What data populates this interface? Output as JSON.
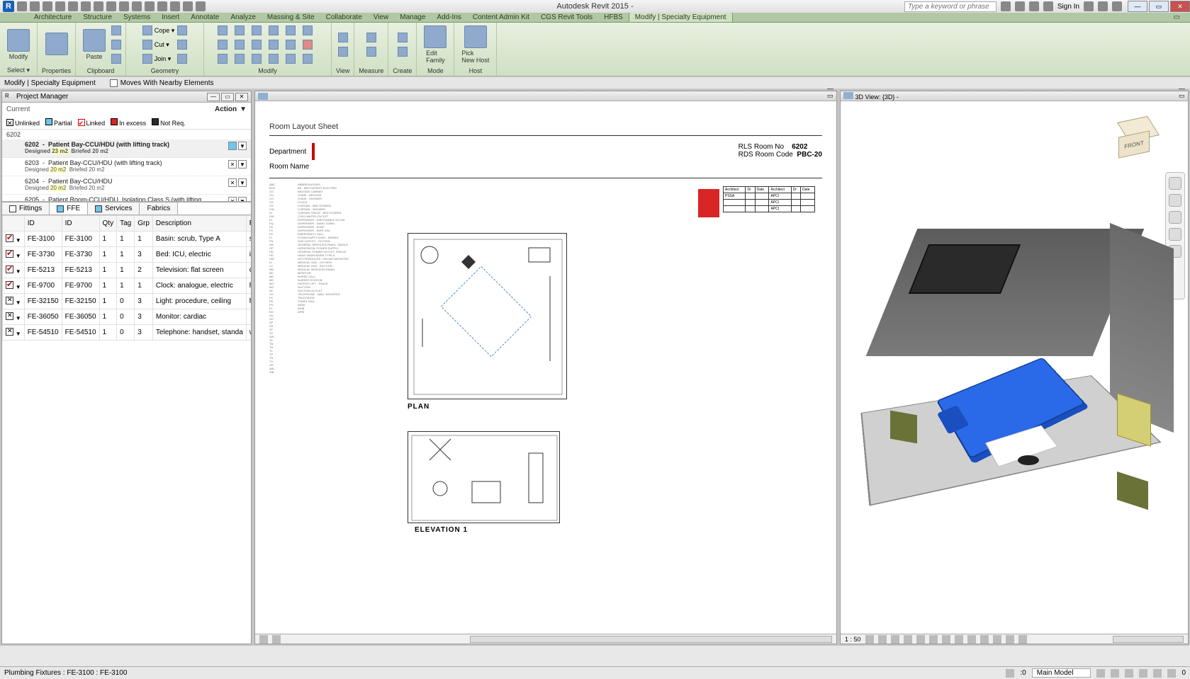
{
  "app": {
    "title": "Autodesk Revit 2015 -",
    "signin": "Sign In",
    "search_placeholder": "Type a keyword or phrase"
  },
  "qat_icons": [
    "open",
    "save",
    "undo",
    "redo",
    "sync",
    "print",
    "measure",
    "text",
    "object",
    "3d",
    "section",
    "window",
    "close-hidden",
    "switch",
    "thin-lines",
    "dropdown"
  ],
  "ribbon_tabs": [
    "Architecture",
    "Structure",
    "Systems",
    "Insert",
    "Annotate",
    "Analyze",
    "Massing & Site",
    "Collaborate",
    "View",
    "Manage",
    "Add-Ins",
    "Content Admin Kit",
    "CGS Revit Tools",
    "HFBS",
    "Modify | Specialty Equipment"
  ],
  "ribbon_active_tab": "Modify | Specialty Equipment",
  "ribbon": {
    "panels": [
      {
        "label": "Select ▾",
        "items": [
          {
            "kind": "big",
            "icon": "cursor",
            "text": "Modify"
          }
        ]
      },
      {
        "label": "Properties",
        "items": [
          {
            "kind": "big",
            "icon": "properties",
            "text": ""
          }
        ]
      },
      {
        "label": "Clipboard",
        "items": [
          {
            "kind": "big",
            "icon": "paste",
            "text": "Paste"
          },
          {
            "kind": "col",
            "rows": [
              {
                "icon": "cut",
                "text": ""
              },
              {
                "icon": "copy",
                "text": ""
              },
              {
                "icon": "match",
                "text": ""
              }
            ]
          }
        ]
      },
      {
        "label": "Geometry",
        "items": [
          {
            "kind": "col",
            "rows": [
              {
                "icon": "cope",
                "text": "Cope ▾"
              },
              {
                "icon": "cut",
                "text": "Cut ▾"
              },
              {
                "icon": "join",
                "text": "Join ▾"
              }
            ]
          },
          {
            "kind": "col",
            "rows": [
              {
                "icon": "g1",
                "text": ""
              },
              {
                "icon": "g2",
                "text": ""
              },
              {
                "icon": "g3",
                "text": ""
              }
            ]
          }
        ]
      },
      {
        "label": "Modify",
        "items": [
          {
            "kind": "grid",
            "icons": [
              "align",
              "offset",
              "mirror-axis",
              "move",
              "copy",
              "rotate",
              "trim",
              "split",
              "array",
              "pin",
              "scale",
              "delete",
              "mirror-pick",
              "trim-ext",
              "split-gap",
              "unpin"
            ]
          }
        ]
      },
      {
        "label": "View",
        "items": [
          {
            "kind": "col",
            "rows": [
              {
                "icon": "v1",
                "text": ""
              },
              {
                "icon": "v2",
                "text": ""
              }
            ]
          }
        ]
      },
      {
        "label": "Measure",
        "items": [
          {
            "kind": "col",
            "rows": [
              {
                "icon": "m1",
                "text": ""
              },
              {
                "icon": "m2",
                "text": ""
              }
            ]
          }
        ]
      },
      {
        "label": "Create",
        "items": [
          {
            "kind": "col",
            "rows": [
              {
                "icon": "c1",
                "text": ""
              },
              {
                "icon": "c2",
                "text": ""
              }
            ]
          }
        ]
      },
      {
        "label": "Mode",
        "items": [
          {
            "kind": "big",
            "icon": "edit-family",
            "text": "Edit\nFamily"
          }
        ]
      },
      {
        "label": "Host",
        "items": [
          {
            "kind": "big",
            "icon": "pick-host",
            "text": "Pick\nNew Host"
          }
        ]
      }
    ]
  },
  "options_bar": {
    "context": "Modify | Specialty Equipment",
    "check1": "Moves With Nearby Elements"
  },
  "pm": {
    "title": "Project Manager",
    "current": "Current",
    "action": "Action",
    "legend": [
      {
        "c": "#ffffff",
        "b": "#000",
        "mark": "x",
        "t": "Unlinked"
      },
      {
        "c": "#6fc6e8",
        "b": "#000",
        "mark": "",
        "t": "Partial"
      },
      {
        "c": "#ffffff",
        "b": "#d00",
        "mark": "v",
        "t": "Linked"
      },
      {
        "c": "#d92525",
        "b": "#000",
        "mark": "",
        "t": "In excess"
      },
      {
        "c": "#2a2a2a",
        "b": "#000",
        "mark": "",
        "t": "Not Req."
      }
    ],
    "code": "6202",
    "rooms": [
      {
        "code": "6202",
        "name": "Patient Bay-CCU/HDU (with lifting track)",
        "d": "23 m2",
        "b": "20 m2",
        "sel": true,
        "icon": "cyan"
      },
      {
        "code": "6203",
        "name": "Patient Bay-CCU/HDU (with lifting track)",
        "d": "20 m2",
        "b": "20 m2",
        "sel": false,
        "icon": "x"
      },
      {
        "code": "6204",
        "name": "Patient Bay-CCU/HDU",
        "d": "20 m2",
        "b": "20 m2",
        "sel": false,
        "icon": "x"
      },
      {
        "code": "6205",
        "name": "Patient Room-CCU/HDU, Isolation Class S (with lifting",
        "d": "",
        "b": "",
        "sel": false,
        "icon": "x"
      }
    ],
    "tabs": [
      {
        "t": "Fittings",
        "c": "#ffffff"
      },
      {
        "t": "FFE",
        "c": "#6fc6e8",
        "active": true
      },
      {
        "t": "Services",
        "c": "#6fc6e8"
      },
      {
        "t": "Fabrics",
        "c": "transparent"
      }
    ],
    "table": {
      "cols": [
        "",
        "ID",
        "ID",
        "Qty",
        "Tag",
        "Grp",
        "Description",
        "R"
      ],
      "rows": [
        {
          "chk": "red",
          "id1": "FE-3100",
          "id2": "FE-3100",
          "qty": "1",
          "tag": "1",
          "grp": "1",
          "desc": "Basin: scrub, Type A",
          "r": "se"
        },
        {
          "chk": "red",
          "id1": "FE-3730",
          "id2": "FE-3730",
          "qty": "1",
          "tag": "1",
          "grp": "3",
          "desc": "Bed: ICU, electric",
          "r": "in"
        },
        {
          "chk": "red",
          "id1": "FE-5213",
          "id2": "FE-5213",
          "qty": "1",
          "tag": "1",
          "grp": "2",
          "desc": "Television: flat screen",
          "r": "ce"
        },
        {
          "chk": "red",
          "id1": "FE-9700",
          "id2": "FE-9700",
          "qty": "1",
          "tag": "1",
          "grp": "1",
          "desc": "Clock: analogue, electric",
          "r": "ha"
        },
        {
          "chk": "x",
          "id1": "FE-32150",
          "id2": "FE-32150",
          "qty": "1",
          "tag": "0",
          "grp": "3",
          "desc": "Light: procedure, ceiling",
          "r": "ha"
        },
        {
          "chk": "x",
          "id1": "FE-36050",
          "id2": "FE-36050",
          "qty": "1",
          "tag": "0",
          "grp": "3",
          "desc": "Monitor: cardiac",
          "r": ""
        },
        {
          "chk": "x",
          "id1": "FE-54510",
          "id2": "FE-54510",
          "qty": "1",
          "tag": "0",
          "grp": "3",
          "desc": "Telephone: handset, standa",
          "r": "wa"
        }
      ]
    }
  },
  "sheet": {
    "title": "Room Layout Sheet",
    "dept_label": "Department",
    "room_label": "Room Name",
    "rls_label": "RLS Room No",
    "rls_value": "6202",
    "rds_label": "RDS Room Code",
    "rds_value": "PBC-20",
    "plan": "PLAN",
    "elev": "ELEVATION 1"
  },
  "view3d": {
    "title": "3D View: {3D} -",
    "scale": "1 : 50",
    "cube_front": "FRONT",
    "cube_top": ""
  },
  "status": {
    "left": "Plumbing Fixtures : FE-3100 : FE-3100",
    "model": "Main Model"
  }
}
